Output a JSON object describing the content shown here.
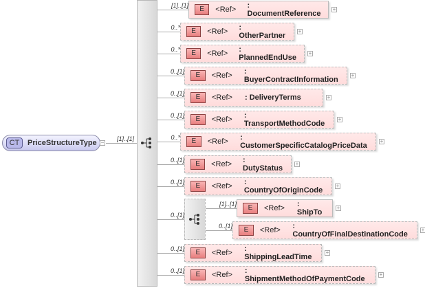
{
  "root": {
    "badge": "CT",
    "name": "PriceStructureType",
    "cardinality": "[1]..[1]"
  },
  "elements": [
    {
      "ref": "<Ref>",
      "name": ": DocumentReference",
      "card": "[1]..[1]"
    },
    {
      "ref": "<Ref>",
      "name": ": OtherPartner",
      "card": "0..*"
    },
    {
      "ref": "<Ref>",
      "name": ": PlannedEndUse",
      "card": "0..*"
    },
    {
      "ref": "<Ref>",
      "name": ": BuyerContractInformation",
      "card": "0..[1]"
    },
    {
      "ref": "<Ref>",
      "name": ": DeliveryTerms",
      "card": "0..[1]"
    },
    {
      "ref": "<Ref>",
      "name": ": TransportMethodCode",
      "card": "0..[1]"
    },
    {
      "ref": "<Ref>",
      "name": ": CustomerSpecificCatalogPriceData",
      "card": "0..*"
    },
    {
      "ref": "<Ref>",
      "name": ": DutyStatus",
      "card": "0..[1]"
    },
    {
      "ref": "<Ref>",
      "name": ": CountryOfOriginCode",
      "card": "0..[1]"
    },
    {
      "ref": "<Ref>",
      "name": ": ShippingLeadTime",
      "card": "0..[1]"
    },
    {
      "ref": "<Ref>",
      "name": ": ShipmentMethodOfPaymentCode",
      "card": "0..[1]"
    }
  ],
  "subsequence": {
    "card": "0..[1]",
    "elements": [
      {
        "ref": "<Ref>",
        "name": ": ShipTo",
        "card": "[1]..[1]"
      },
      {
        "ref": "<Ref>",
        "name": ": CountryOfFinalDestinationCode",
        "card": "0..[1]"
      }
    ]
  },
  "element_badge": "E",
  "colors": {
    "element": "#ffdcdc",
    "complex_type": "#c9c9ee"
  }
}
